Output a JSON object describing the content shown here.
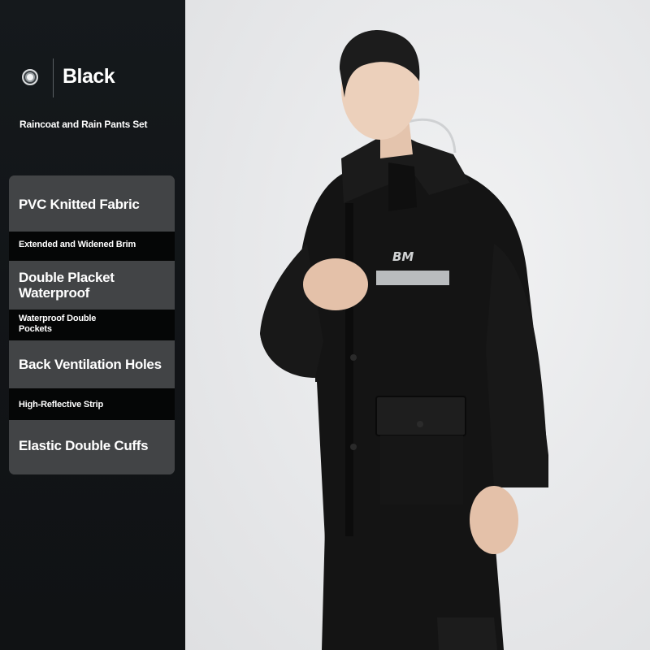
{
  "color_option": {
    "name": "Black",
    "subtitle": "Raincoat and Rain Pants Set"
  },
  "features": [
    "PVC Knitted Fabric",
    "Extended and Widened Brim",
    "Double Placket\nWaterproof",
    "Waterproof Double\nPockets",
    "Back Ventilation Holes",
    "High-Reflective Strip",
    "Elastic Double Cuffs"
  ],
  "product_photo": {
    "logo": "BM",
    "garment_color": "#141414",
    "reflective_strip_color": "#b9bcbe"
  },
  "colors": {
    "panel_dark": "#121518",
    "feature_block": "#424446",
    "feature_strip": "#050606",
    "background": "#e9eaec"
  }
}
